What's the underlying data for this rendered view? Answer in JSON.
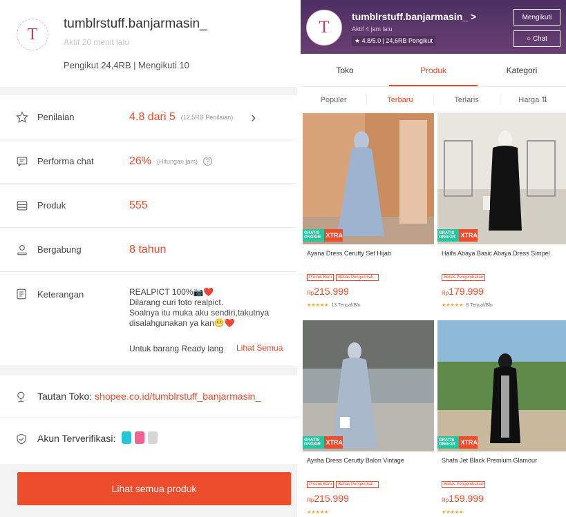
{
  "left": {
    "shop_name": "tumblrstuff.banjarmasin_",
    "active": "Aktif 20 menit lalu",
    "followers": "Pengikut 24,4RB | Mengikuti 10",
    "rows": [
      {
        "label": "Penilaian",
        "value": "4.8 dari 5",
        "note": "(12.5RB Penilaian)"
      },
      {
        "label": "Performa chat",
        "value": "26%",
        "note": "(Hitungan jam)"
      },
      {
        "label": "Produk",
        "value": "555",
        "note": ""
      },
      {
        "label": "Bergabung",
        "value": "8 tahun",
        "note": ""
      }
    ],
    "keterangan": {
      "label": "Keterangan",
      "line1": "REALPICT 100%📷❤️",
      "line2": "Dilarang curi foto realpict.",
      "line3": "Soalnya itu muka aku sendiri,takutnya",
      "line4": "disalahgunakan ya kan😬❤️",
      "ready": "Untuk barang Ready lang",
      "see_all": "Lihat Semua"
    },
    "link_label": "Tautan Toko:",
    "link_url": "shopee.co.id/tumblrstuff_banjarmasin_",
    "verified_label": "Akun Terverifikasi:",
    "cta": "Lihat semua produk"
  },
  "right": {
    "shop_name": "tumblrstuff.banjarmasin_ >",
    "active": "Aktif 4 jam lalu",
    "rating": "★ 4.8/5.0  |  24,6RB Pengikut",
    "follow_btn": "Mengikuti",
    "chat_btn": "○ Chat",
    "tabs": [
      "Toko",
      "Produk",
      "Kategori"
    ],
    "sorts": [
      "Populer",
      "Terbaru",
      "Terlaris",
      "Harga ⇅"
    ],
    "xtra": "XTRA",
    "gratis": "GRATIS ONGKIR",
    "products": [
      {
        "title": "Ayana Dress Cerutty Set Hijab",
        "tags": [
          "Produk Baru",
          "Bebas Pengembali..."
        ],
        "price_cur": "Rp",
        "price": "215.999",
        "sold": "13 Terjual/Bln",
        "stars": "★★★★★"
      },
      {
        "title": "Haifa Abaya Basic Abaya Dress Simpel",
        "tags": [
          "Bebas Pengembalian"
        ],
        "price_cur": "Rp",
        "price": "179.999",
        "sold": "8 Terjual/Bln",
        "stars": "★★★★★"
      },
      {
        "title": "Aysha Dress Cerutty Balon Vintage",
        "tags": [
          "Produk Baru",
          "Bebas Pengembali..."
        ],
        "price_cur": "Rp",
        "price": "215.999",
        "sold": "",
        "stars": "★★★★★"
      },
      {
        "title": "Shafa Jet Black Premium Glamour",
        "tags": [
          "Bebas Pengembalian"
        ],
        "price_cur": "Rp",
        "price": "159.999",
        "sold": "",
        "stars": "★★★★★"
      }
    ]
  },
  "colors": {
    "accent": "#ee4d2d",
    "header": "#5b3a6b"
  }
}
